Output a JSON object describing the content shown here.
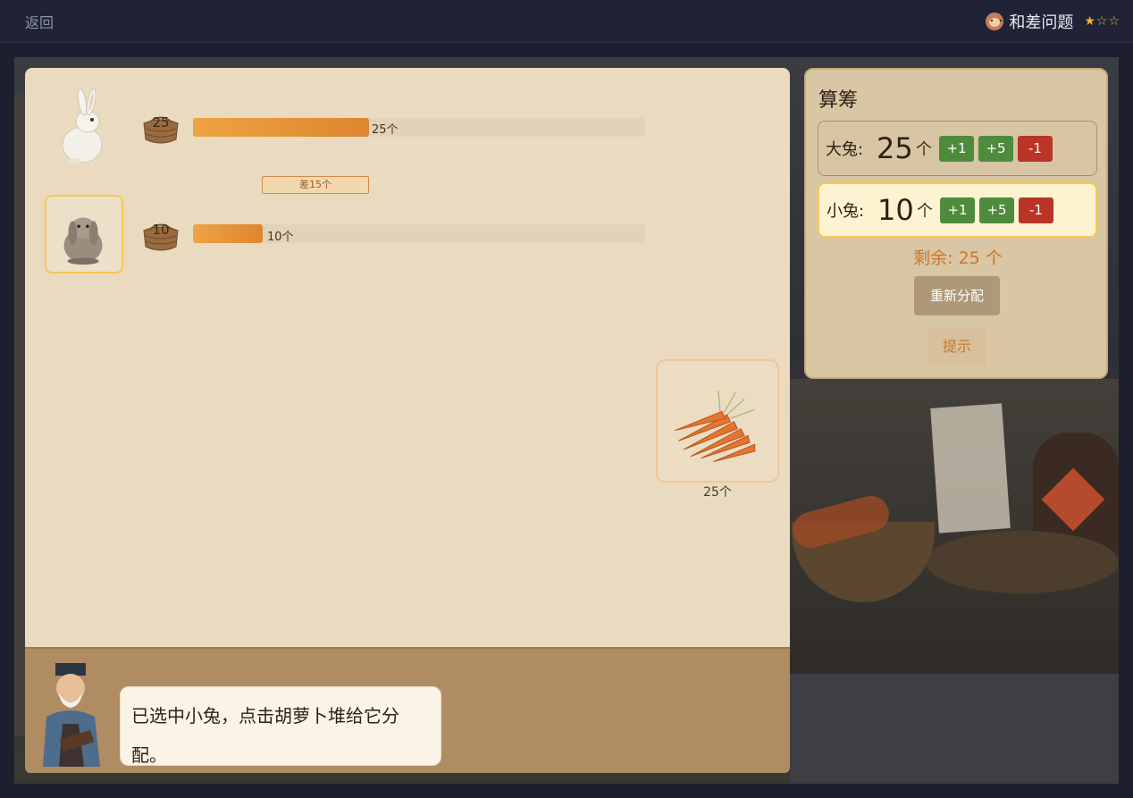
{
  "header": {
    "back_label": "返回",
    "title": "和差问题",
    "stars": "★☆☆"
  },
  "board": {
    "big_rabbit": {
      "basket_value": "25",
      "bar_label": "25个",
      "fill_fraction": 0.39
    },
    "small_rabbit": {
      "basket_value": "10",
      "bar_label": "10个",
      "fill_fraction": 0.155
    },
    "difference_label": "差15个",
    "carrot_pile_count": "25个"
  },
  "dialog": {
    "message": "已选中小兔，点击胡萝卜堆给它分配。"
  },
  "panel": {
    "title": "算筹",
    "rows": [
      {
        "label": "大兔:",
        "value": "25",
        "unit": "个",
        "plus1": "+1",
        "plus5": "+5",
        "minus1": "-1"
      },
      {
        "label": "小兔:",
        "value": "10",
        "unit": "个",
        "plus1": "+1",
        "plus5": "+5",
        "minus1": "-1"
      }
    ],
    "remaining": "剩余: 25 个",
    "redistribute_label": "重新分配",
    "hint_label": "提示"
  },
  "colors": {
    "accent_yellow": "#f4c94f",
    "bar_orange": "#eda443",
    "button_green": "#4f8b3d",
    "button_red": "#b93527",
    "remaining_orange": "#c9772a"
  },
  "icons": [
    "monkey-icon",
    "white-rabbit-icon",
    "gray-rabbit-icon",
    "basket-icon",
    "carrot-pile-icon",
    "teacher-icon"
  ]
}
